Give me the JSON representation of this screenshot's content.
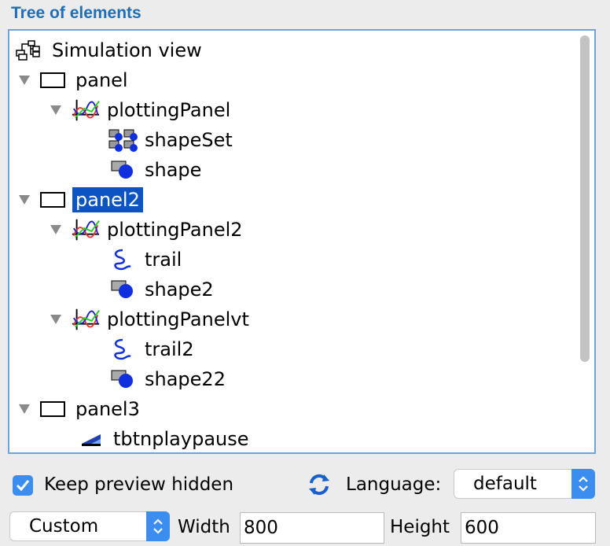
{
  "panel_title": "Tree of elements",
  "tree": {
    "root": {
      "label": "Simulation view",
      "icon": "tree-structure-icon"
    },
    "items": [
      {
        "label": "panel",
        "icon": "panel-icon",
        "expanded": true
      },
      {
        "label": "plottingPanel",
        "icon": "plot-icon",
        "expanded": true
      },
      {
        "label": "shapeSet",
        "icon": "shape-set-icon"
      },
      {
        "label": "shape",
        "icon": "shape-icon"
      },
      {
        "label": "panel2",
        "icon": "panel-icon",
        "expanded": true,
        "selected": true
      },
      {
        "label": "plottingPanel2",
        "icon": "plot-icon",
        "expanded": true
      },
      {
        "label": "trail",
        "icon": "trail-icon"
      },
      {
        "label": "shape2",
        "icon": "shape-icon"
      },
      {
        "label": "plottingPanelvt",
        "icon": "plot-icon",
        "expanded": true
      },
      {
        "label": "trail2",
        "icon": "trail-icon"
      },
      {
        "label": "shape22",
        "icon": "shape-icon"
      },
      {
        "label": "panel3",
        "icon": "panel-icon",
        "expanded": true
      },
      {
        "label": "tbtnplaypause",
        "icon": "toggle-button-icon"
      }
    ]
  },
  "options": {
    "keep_preview_label": "Keep preview hidden",
    "keep_preview_checked": true,
    "language_label": "Language:",
    "language_value": "default",
    "size_preset": "Custom",
    "width_label": "Width",
    "width_value": "800",
    "height_label": "Height",
    "height_value": "600"
  },
  "colors": {
    "accent": "#3b8ef0",
    "title": "#1f6fb8",
    "selection": "#0b54c2",
    "frame_border": "#6fa3d9"
  }
}
